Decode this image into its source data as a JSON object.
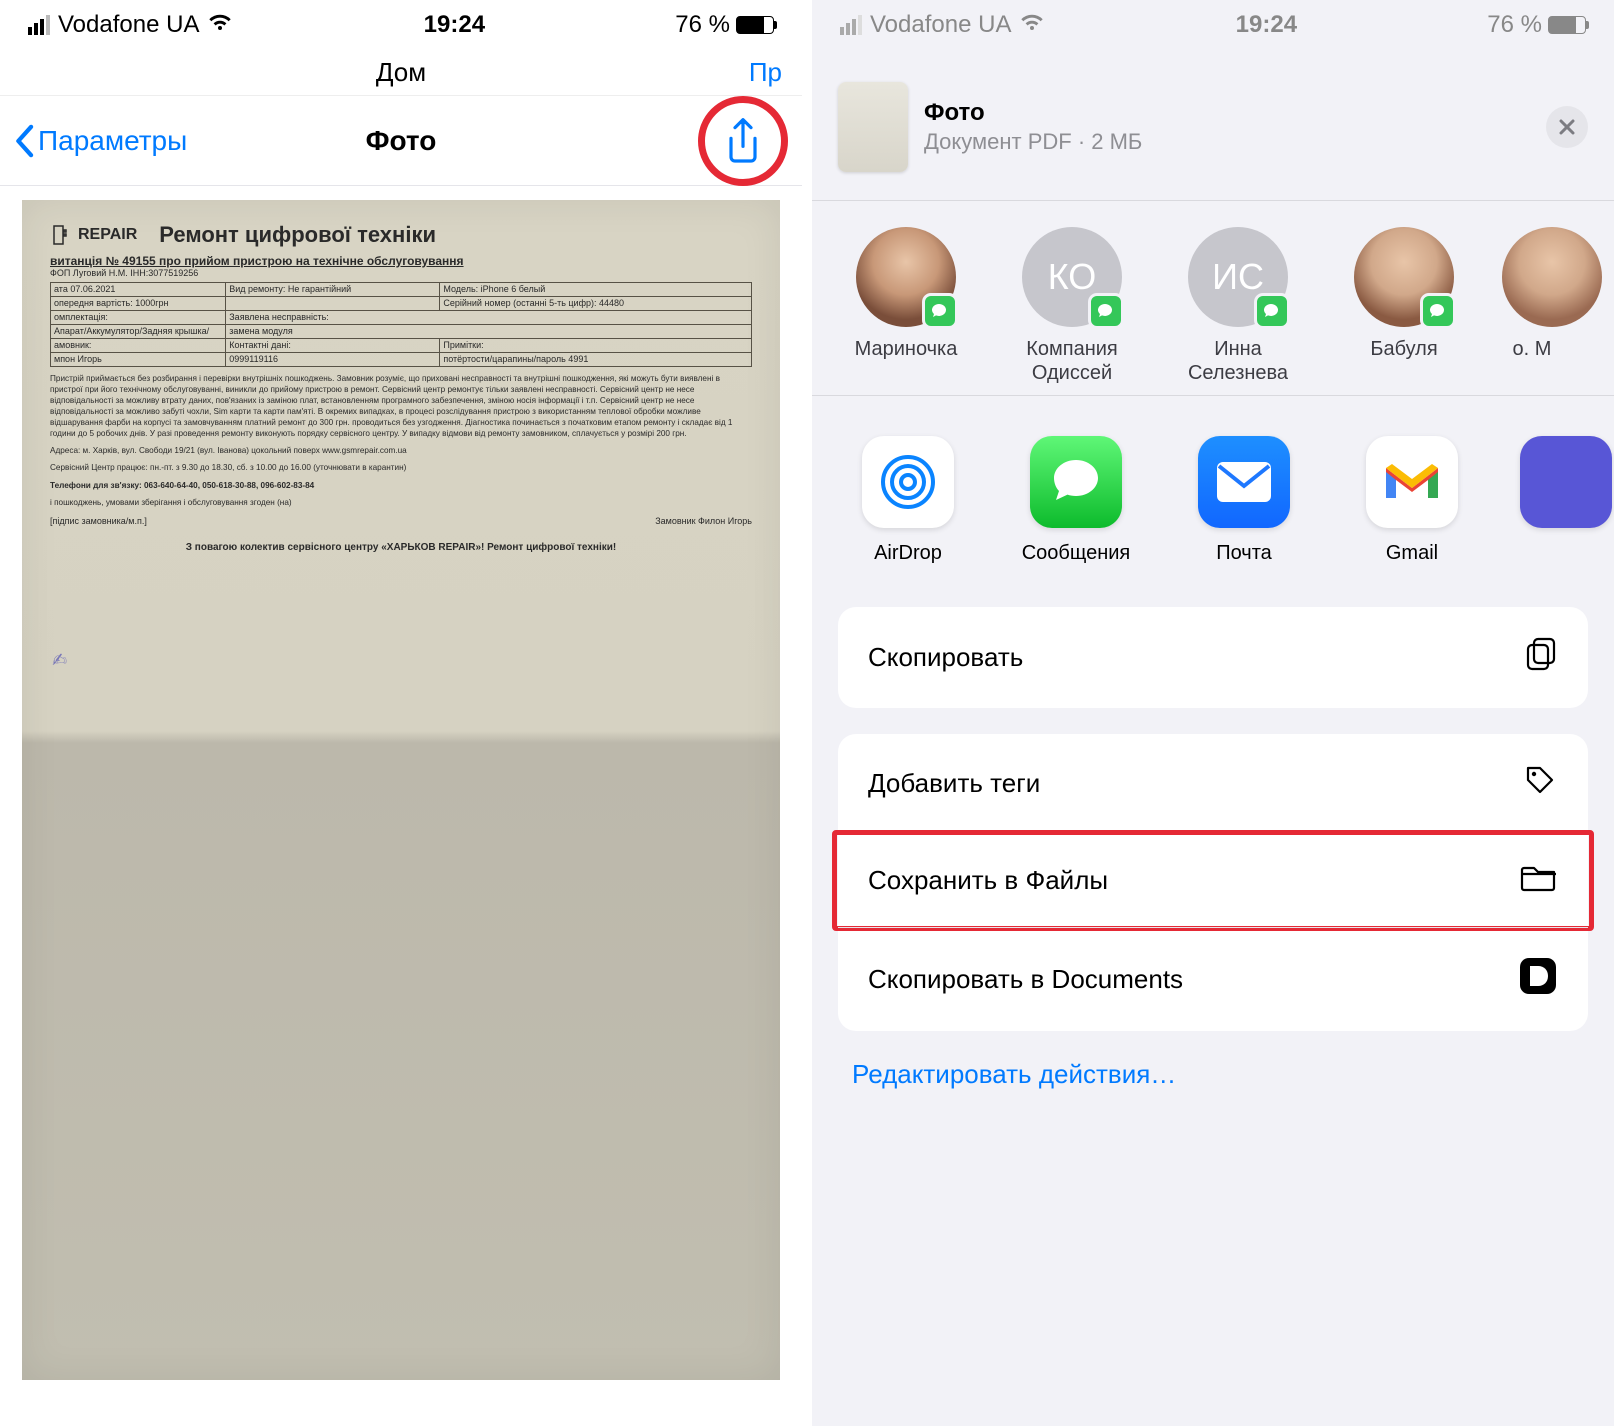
{
  "statusbar": {
    "carrier": "Vodafone UA",
    "time": "19:24",
    "battery_pct": "76 %"
  },
  "left": {
    "behind_title": "Дом",
    "behind_edit": "Пр",
    "back_label": "Параметры",
    "title": "Фото",
    "doc": {
      "brand": "REPAIR",
      "heading": "Ремонт цифрової техніки",
      "receipt": "витанція № 49155 про прийом пристрою на технічне обслуговування",
      "fop": "ФОП Луговий Н.М.  ІНН:3077519256",
      "r1c1": "ата  07.06.2021",
      "r1c2": "Вид ремонту: Не гарантійний",
      "r1c3": "Модель: iPhone  6 белый",
      "r2c1": "опередня вартість: 1000грн",
      "r2c2": "",
      "r2c3": "Серійний номер (останні 5-ть цифр): 44480",
      "r3c1": "омплектація:",
      "r3c2": "Заявлена несправність:",
      "r3c3": "",
      "r4c1": "Апарат/Аккумулятор/Задняя крышка/",
      "r4c2": "замена модуля",
      "r4c3": "",
      "r5c1": "амовник:",
      "r5c2": "Контактні дані:",
      "r5c3": "Примітки:",
      "r6c1": "мпон Игорь",
      "r6c2": "0999119116",
      "r6c3": "потёртости/царапины/пароль 4991",
      "fine": "Пристрій приймається без розбирання і перевірки внутрішніх пошкоджень. Замовник розуміє, що приховані несправності та внутрішні пошкодження, які можуть бути виявлені в пристрої при його технічному обслуговуванні, виникли до прийому пристрою в ремонт. Сервісний центр ремонтує тільки заявлені несправності. Сервісний центр не несе відповідальності за можливу втрату даних, пов'язаних із заміною плат, встановленням програмного забезпечення, зміною носія інформації і т.п. Сервісний центр не несе відповідальності за можливо забуті чохли, Sim карти та карти пам'яті. В окремих випадках, в процесі розслідування пристрою з використанням теплової обробки можливе відшарування фарби на корпусі та замовчуванням платний ремонт до 300 грн. проводиться без узгодження. Діагностика починається з початковим етапом ремонту і складає від 1 години до 5 робочих днів. У разі проведення ремонту виконують порядку сервісного центру. У випадку відмови від ремонту замовником, сплачується у розмірі 200 грн.",
      "address": "Адреса: м. Харків, вул. Свободи 19/21 (вул. Іванова) цокольний поверх www.gsmrepair.com.ua",
      "hours": "Сервісний Центр працює: пн.-пт. з 9.30 до 18.30, сб. з 10.00 до 16.00 (уточнювати в карантин)",
      "phones": "Телефони для зв'язку: 063-640-64-40, 050-618-30-88, 096-602-83-84",
      "agree_line": "і пошкоджень, умовами зберігання і обслуговування згоден (на)",
      "sign_left": "[підпис замовника/м.п.]",
      "sign_right": "Замовник            Филон Игорь",
      "footer": "З повагою колектив сервісного центру «ХАРЬКОВ REPAIR»! Ремонт цифрової техніки!"
    }
  },
  "right": {
    "sheet_title": "Фото",
    "sheet_sub": "Документ PDF · 2 МБ",
    "contacts": [
      {
        "name": "Мариночка",
        "initials": "",
        "photo": "1"
      },
      {
        "name": "Компания Одиссей",
        "initials": "КО",
        "photo": ""
      },
      {
        "name": "Инна Селезнева",
        "initials": "ИС",
        "photo": ""
      },
      {
        "name": "Бабуля",
        "initials": "",
        "photo": "2"
      },
      {
        "name": "о. М",
        "initials": "",
        "photo": "3"
      }
    ],
    "apps": [
      {
        "name": "AirDrop"
      },
      {
        "name": "Сообщения"
      },
      {
        "name": "Почта"
      },
      {
        "name": "Gmail"
      }
    ],
    "actions": {
      "copy": "Скопировать",
      "tags": "Добавить теги",
      "save_files": "Сохранить в Файлы",
      "copy_docs": "Скопировать в Documents"
    },
    "edit_actions": "Редактировать действия…"
  }
}
